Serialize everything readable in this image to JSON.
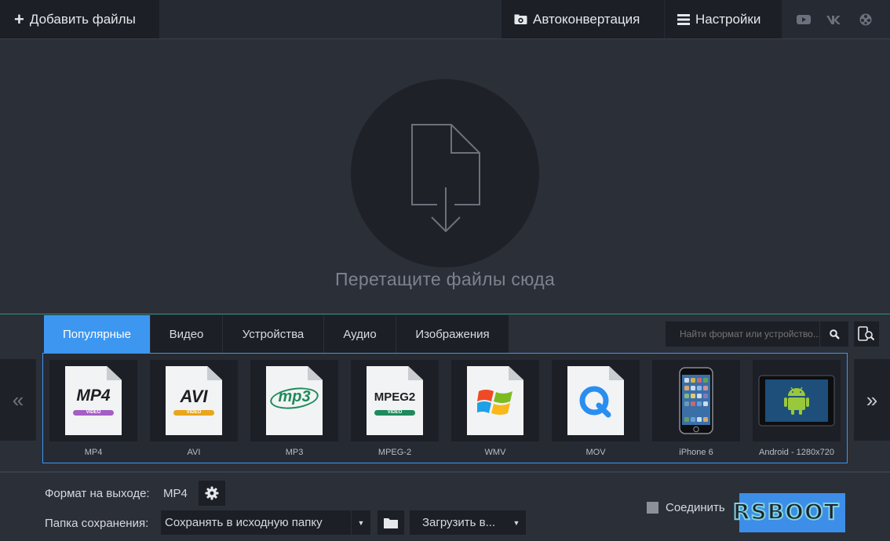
{
  "topbar": {
    "add_files_label": "Добавить файлы",
    "autoconvert_label": "Автоконвертация",
    "settings_label": "Настройки",
    "social_icons": [
      "youtube-icon",
      "vk-icon",
      "movavi-icon"
    ]
  },
  "dropzone": {
    "hint": "Перетащите файлы сюда",
    "icon": "file-download-icon"
  },
  "format_panel": {
    "tabs": [
      {
        "label": "Популярные",
        "active": true
      },
      {
        "label": "Видео",
        "active": false
      },
      {
        "label": "Устройства",
        "active": false
      },
      {
        "label": "Аудио",
        "active": false
      },
      {
        "label": "Изображения",
        "active": false
      }
    ],
    "search_placeholder": "Найти формат или устройство...",
    "prev_arrow": "«",
    "next_arrow": "»",
    "formats": [
      {
        "caption": "MP4",
        "logo": "MP4",
        "badge": "VIDEO",
        "badge_color": "#a45fc4"
      },
      {
        "caption": "AVI",
        "logo": "AVI",
        "badge": "VIDEO",
        "badge_color": "#e8a61a"
      },
      {
        "caption": "MP3",
        "logo": "mp3",
        "badge": "",
        "badge_color": "#1f8a5b"
      },
      {
        "caption": "MPEG-2",
        "logo": "MPEG2",
        "badge": "VIDEO",
        "badge_color": "#1f8a5b"
      },
      {
        "caption": "WMV",
        "logo": "",
        "badge": "",
        "badge_color": ""
      },
      {
        "caption": "MOV",
        "logo": "",
        "badge": "",
        "badge_color": ""
      },
      {
        "caption": "iPhone 6",
        "logo": "",
        "badge": "",
        "badge_color": ""
      },
      {
        "caption": "Android - 1280x720",
        "logo": "",
        "badge": "",
        "badge_color": ""
      }
    ]
  },
  "bottom": {
    "output_format_label": "Формат на выходе:",
    "output_format_value": "MP4",
    "save_folder_label": "Папка сохранения:",
    "save_folder_value": "Сохранять в исходную папку",
    "upload_label": "Загрузить в...",
    "join_label": "Соединить",
    "watermark": "RSBOOT"
  },
  "colors": {
    "accent": "#3d97f0",
    "panel_dark": "#1c1f25",
    "background": "#2b2f38",
    "divider_green": "#2f8f7a"
  }
}
